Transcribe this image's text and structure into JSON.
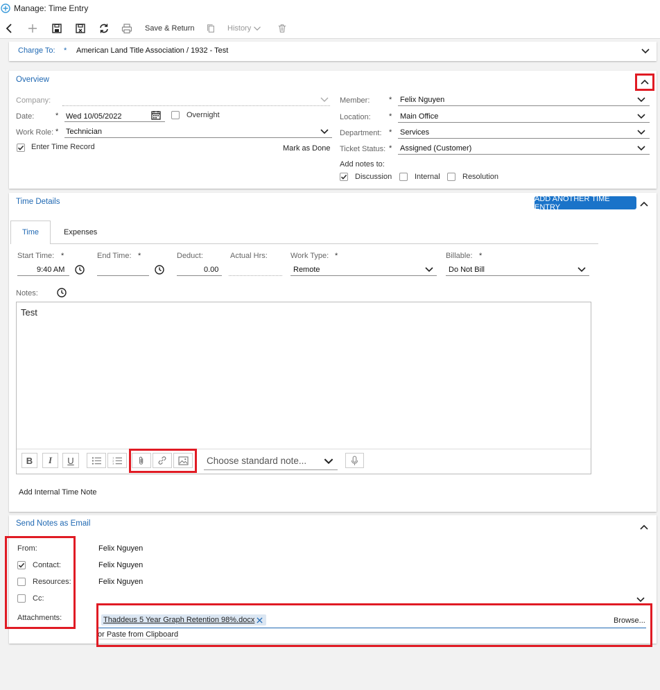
{
  "window": {
    "title": "Manage: Time Entry"
  },
  "toolbar": {
    "save_return_label": "Save & Return",
    "history_label": "History"
  },
  "charge_to": {
    "label": "Charge To:",
    "value": "American Land Title Association / 1932 - Test"
  },
  "overview": {
    "title": "Overview",
    "company_label": "Company:",
    "date_label": "Date:",
    "date_value": "Wed 10/05/2022",
    "overnight_label": "Overnight",
    "work_role_label": "Work Role:",
    "work_role_value": "Technician",
    "enter_time_record_label": "Enter Time Record",
    "mark_as_done_label": "Mark as Done",
    "member_label": "Member:",
    "member_value": "Felix Nguyen",
    "location_label": "Location:",
    "location_value": "Main Office",
    "department_label": "Department:",
    "department_value": "Services",
    "ticket_status_label": "Ticket Status:",
    "ticket_status_value": "Assigned (Customer)",
    "add_notes_label": "Add notes to:",
    "discussion_label": "Discussion",
    "internal_label": "Internal",
    "resolution_label": "Resolution"
  },
  "time_details": {
    "title": "Time Details",
    "add_button_label": "ADD ANOTHER TIME ENTRY",
    "tabs": [
      "Time",
      "Expenses"
    ],
    "start_time_label": "Start Time:",
    "start_time_value": "9:40 AM",
    "end_time_label": "End Time:",
    "deduct_label": "Deduct:",
    "deduct_value": "0.00",
    "actual_hrs_label": "Actual Hrs:",
    "work_type_label": "Work Type:",
    "work_type_value": "Remote",
    "billable_label": "Billable:",
    "billable_value": "Do Not Bill",
    "notes_label": "Notes:",
    "notes_value": "Test",
    "standard_note_placeholder": "Choose standard note...",
    "add_internal_note_label": "Add Internal Time Note"
  },
  "send_notes": {
    "title": "Send Notes as Email",
    "from_label": "From:",
    "from_value": "Felix Nguyen",
    "contact_label": "Contact:",
    "contact_value": "Felix Nguyen",
    "resources_label": "Resources:",
    "resources_value": "Felix Nguyen",
    "cc_label": "Cc:",
    "attachments_label": "Attachments:",
    "attachment_file": "Thaddeus 5 Year Graph Retention 98%.docx",
    "browse_label": "Browse...",
    "paste_label": "or Paste from Clipboard"
  },
  "colors": {
    "accent": "#2069b3",
    "highlight_border": "#e01b24",
    "button_bg": "#1a73c9"
  }
}
